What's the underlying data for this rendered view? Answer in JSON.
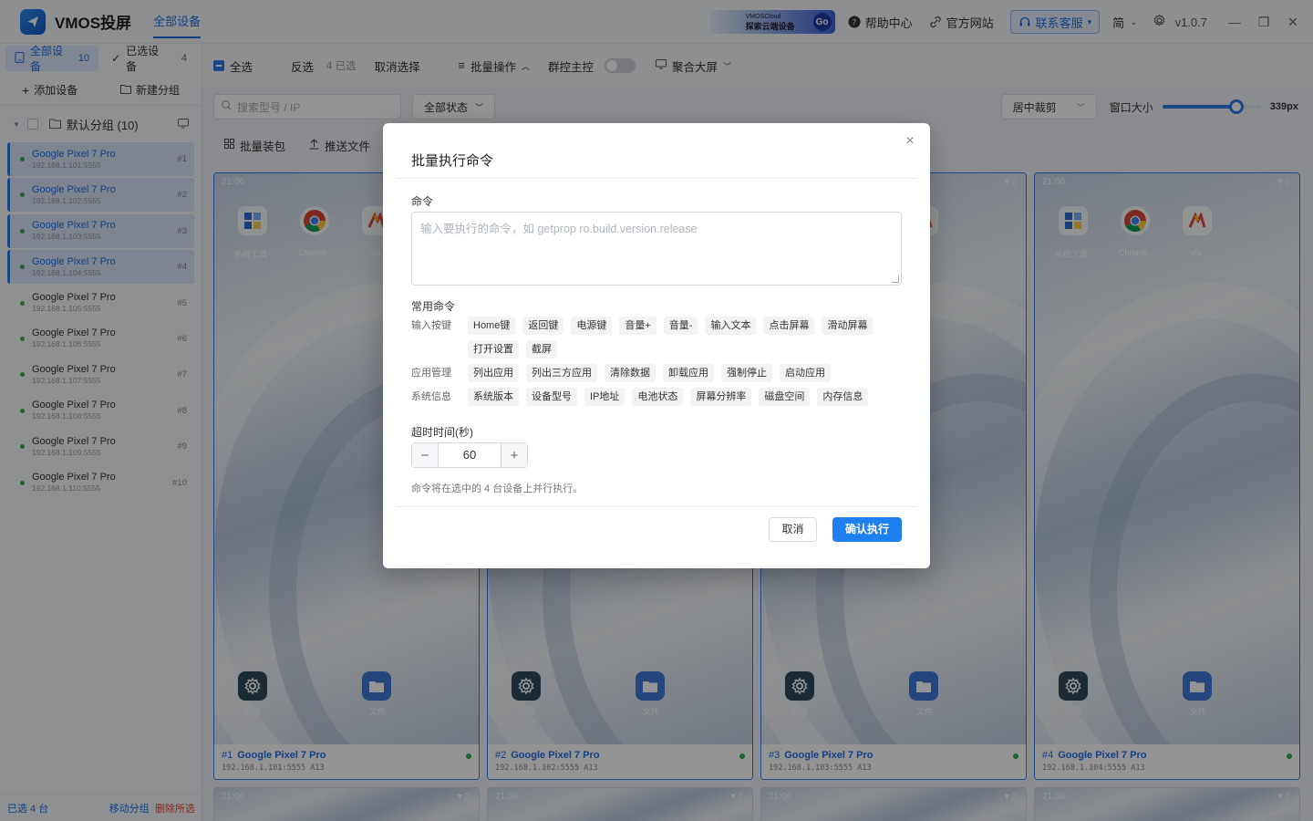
{
  "app": {
    "name": "VMOS投屏",
    "nav": "全部设备",
    "version": "v1.0.7"
  },
  "titlebar": {
    "promo_line1": "VMOSCloud",
    "promo_line2": "探索云端设备",
    "promo_go": "Go",
    "help": "帮助中心",
    "website": "官方网站",
    "contact": "联系客服",
    "lang": "简"
  },
  "sidebar": {
    "tab_all": "全部设备",
    "tab_all_count": "10",
    "tab_selected": "已选设备",
    "tab_selected_count": "4",
    "add_device": "添加设备",
    "new_group": "新建分组",
    "group_name": "默认分组 (10)",
    "devices": [
      {
        "name": "Google Pixel 7 Pro",
        "ip": "192.168.1.101:5555",
        "idx": "#1"
      },
      {
        "name": "Google Pixel 7 Pro",
        "ip": "192.168.1.102:5555",
        "idx": "#2"
      },
      {
        "name": "Google Pixel 7 Pro",
        "ip": "192.168.1.103:5555",
        "idx": "#3"
      },
      {
        "name": "Google Pixel 7 Pro",
        "ip": "192.168.1.104:5555",
        "idx": "#4"
      },
      {
        "name": "Google Pixel 7 Pro",
        "ip": "192.168.1.105:5555",
        "idx": "#5"
      },
      {
        "name": "Google Pixel 7 Pro",
        "ip": "192.168.1.106:5555",
        "idx": "#6"
      },
      {
        "name": "Google Pixel 7 Pro",
        "ip": "192.168.1.107:5555",
        "idx": "#7"
      },
      {
        "name": "Google Pixel 7 Pro",
        "ip": "192.168.1.108:5555",
        "idx": "#8"
      },
      {
        "name": "Google Pixel 7 Pro",
        "ip": "192.168.1.109:5555",
        "idx": "#9"
      },
      {
        "name": "Google Pixel 7 Pro",
        "ip": "192.168.1.110:5555",
        "idx": "#10"
      }
    ],
    "footer_selected": "已选 4 台",
    "footer_move": "移动分组",
    "footer_delete": "删除所选"
  },
  "toolbar": {
    "select_all": "全选",
    "invert": "反选",
    "selected_count": "4 已选",
    "deselect": "取消选择",
    "batch": "批量操作",
    "group_control": "群控主控",
    "big_screen": "聚合大屏"
  },
  "filter": {
    "search_placeholder": "搜索型号 / IP",
    "status": "全部状态",
    "crop": "居中裁剪",
    "window_size_label": "窗口大小",
    "window_size_value": "339px",
    "window_size_fraction": 0.75
  },
  "actions": {
    "batch_install": "批量装包",
    "push_file": "推送文件"
  },
  "cards": [
    {
      "idx": "#1",
      "name": "Google Pixel 7 Pro",
      "ip": "192.168.1.101:5555 A13",
      "time": "21:06"
    },
    {
      "idx": "#2",
      "name": "Google Pixel 7 Pro",
      "ip": "192.168.1.102:5555 A13",
      "time": "21:06"
    },
    {
      "idx": "#3",
      "name": "Google Pixel 7 Pro",
      "ip": "192.168.1.103:5555 A13",
      "time": "21:06"
    },
    {
      "idx": "#4",
      "name": "Google Pixel 7 Pro",
      "ip": "192.168.1.104:5555 A13",
      "time": "21:06"
    }
  ],
  "next_row_time": "21:06",
  "screen_apps": {
    "tools": "系统工具",
    "chrome": "Chrome",
    "via": "Via",
    "settings": "设置",
    "files": "文件"
  },
  "modal": {
    "title": "批量执行命令",
    "cmd_label": "命令",
    "cmd_placeholder": "输入要执行的命令，如 getprop ro.build.version.release",
    "common_label": "常用命令",
    "categories": [
      {
        "name": "输入按键",
        "items": [
          "Home键",
          "返回键",
          "电源键",
          "音量+",
          "音量-",
          "输入文本",
          "点击屏幕",
          "滑动屏幕",
          "打开设置",
          "截屏"
        ]
      },
      {
        "name": "应用管理",
        "items": [
          "列出应用",
          "列出三方应用",
          "清除数据",
          "卸载应用",
          "强制停止",
          "启动应用"
        ]
      },
      {
        "name": "系统信息",
        "items": [
          "系统版本",
          "设备型号",
          "IP地址",
          "电池状态",
          "屏幕分辨率",
          "磁盘空间",
          "内存信息"
        ]
      }
    ],
    "timeout_label": "超时时间(秒)",
    "timeout_value": "60",
    "hint": "命令将在选中的 4 台设备上并行执行。",
    "cancel": "取消",
    "confirm": "确认执行"
  }
}
